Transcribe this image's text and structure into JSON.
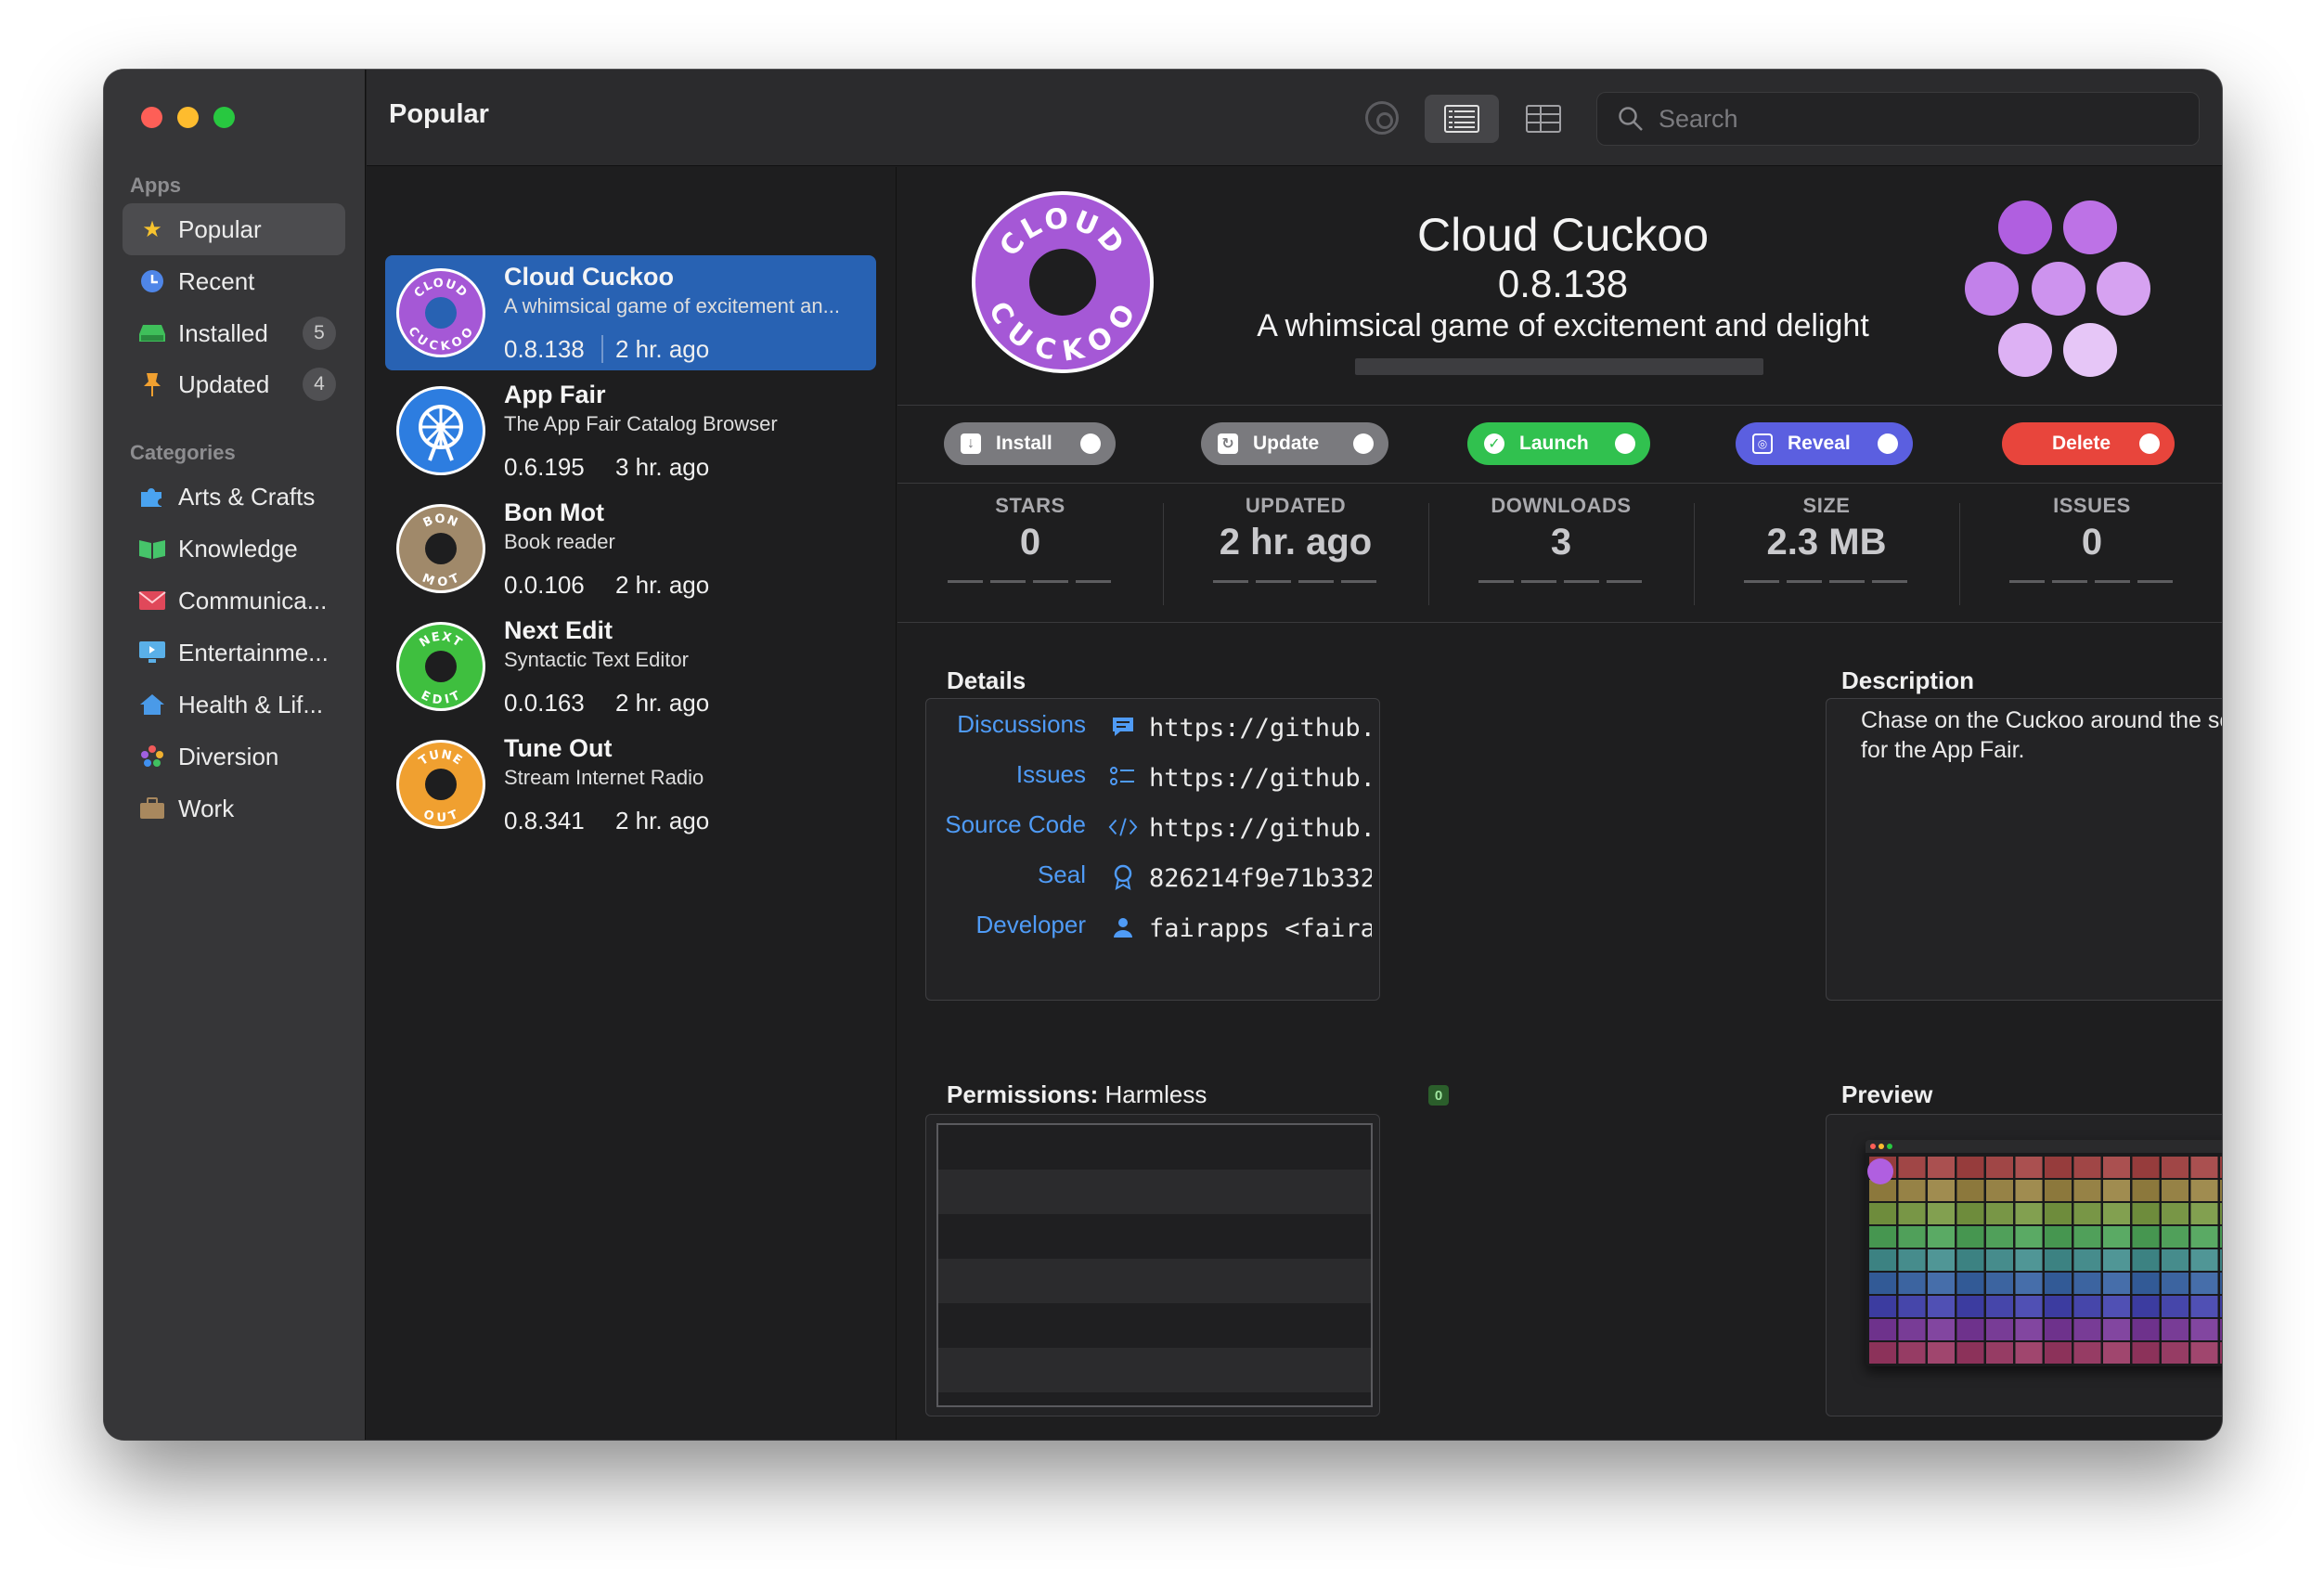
{
  "sidebar": {
    "apps_header": "Apps",
    "categories_header": "Categories",
    "items": [
      {
        "label": "Popular",
        "icon": "star-icon"
      },
      {
        "label": "Recent",
        "icon": "clock-icon"
      },
      {
        "label": "Installed",
        "icon": "drive-icon",
        "badge": "5"
      },
      {
        "label": "Updated",
        "icon": "pin-icon",
        "badge": "4"
      }
    ],
    "categories": [
      {
        "label": "Arts & Crafts",
        "icon": "puzzle-icon"
      },
      {
        "label": "Knowledge",
        "icon": "book-icon"
      },
      {
        "label": "Communica...",
        "icon": "envelope-icon"
      },
      {
        "label": "Entertainme...",
        "icon": "display-icon"
      },
      {
        "label": "Health & Lif...",
        "icon": "house-icon"
      },
      {
        "label": "Diversion",
        "icon": "flower-icon"
      },
      {
        "label": "Work",
        "icon": "briefcase-icon"
      }
    ]
  },
  "toolbar": {
    "title": "Popular",
    "search_placeholder": "Search"
  },
  "apps": [
    {
      "name": "Cloud Cuckoo",
      "subtitle": "A whimsical game of excitement an...",
      "version": "0.8.138",
      "date": "2 hr. ago",
      "icon_word_top": "CLOUD",
      "icon_word_bottom": "CUCKOO",
      "color": "#a558d6"
    },
    {
      "name": "App Fair",
      "subtitle": "The App Fair Catalog Browser",
      "version": "0.6.195",
      "date": "3 hr. ago",
      "color": "#2d7de0"
    },
    {
      "name": "Bon Mot",
      "subtitle": "Book reader",
      "version": "0.0.106",
      "date": "2 hr. ago",
      "icon_word_top": "BON",
      "icon_word_bottom": "MOT",
      "color": "#a0896a"
    },
    {
      "name": "Next Edit",
      "subtitle": "Syntactic Text Editor",
      "version": "0.0.163",
      "date": "2 hr. ago",
      "icon_word_top": "NEXT",
      "icon_word_bottom": "EDIT",
      "color": "#3fbf3f"
    },
    {
      "name": "Tune Out",
      "subtitle": "Stream Internet Radio",
      "version": "0.8.341",
      "date": "2 hr. ago",
      "icon_word_top": "TUNE",
      "icon_word_bottom": "OUT",
      "color": "#f0a030"
    }
  ],
  "detail": {
    "name": "Cloud Cuckoo",
    "version": "0.8.138",
    "subtitle": "A whimsical game of excitement and delight",
    "icon_word_top": "CLOUD",
    "icon_word_bottom": "CUCKOO",
    "actions": [
      {
        "label": "Install",
        "color": "#7a7a7e"
      },
      {
        "label": "Update",
        "color": "#7a7a7e"
      },
      {
        "label": "Launch",
        "color": "#31c14f"
      },
      {
        "label": "Reveal",
        "color": "#5b5fe0"
      },
      {
        "label": "Delete",
        "color": "#e8453c"
      }
    ],
    "stats": [
      {
        "label": "STARS",
        "value": "0"
      },
      {
        "label": "UPDATED",
        "value": "2 hr. ago"
      },
      {
        "label": "DOWNLOADS",
        "value": "3"
      },
      {
        "label": "SIZE",
        "value": "2.3 MB"
      },
      {
        "label": "ISSUES",
        "value": "0"
      }
    ],
    "details_title": "Details",
    "details": [
      {
        "label": "Discussions",
        "value": "https://github.",
        "icon": "speech-bubble-icon"
      },
      {
        "label": "Issues",
        "value": "https://github.",
        "icon": "checklist-icon"
      },
      {
        "label": "Source Code",
        "value": "https://github.",
        "icon": "code-brackets-icon"
      },
      {
        "label": "Seal",
        "value": "826214f9e71b332",
        "icon": "seal-ribbon-icon"
      },
      {
        "label": "Developer",
        "value": "fairapps <faira",
        "icon": "person-icon"
      }
    ],
    "description_title": "Description",
    "description": "Chase on the Cuckoo around the screen!This is a silly little game for the App Fair.",
    "permissions_label": "Permissions:",
    "permissions_value": "Harmless",
    "permissions_count": "0",
    "preview_title": "Preview"
  }
}
